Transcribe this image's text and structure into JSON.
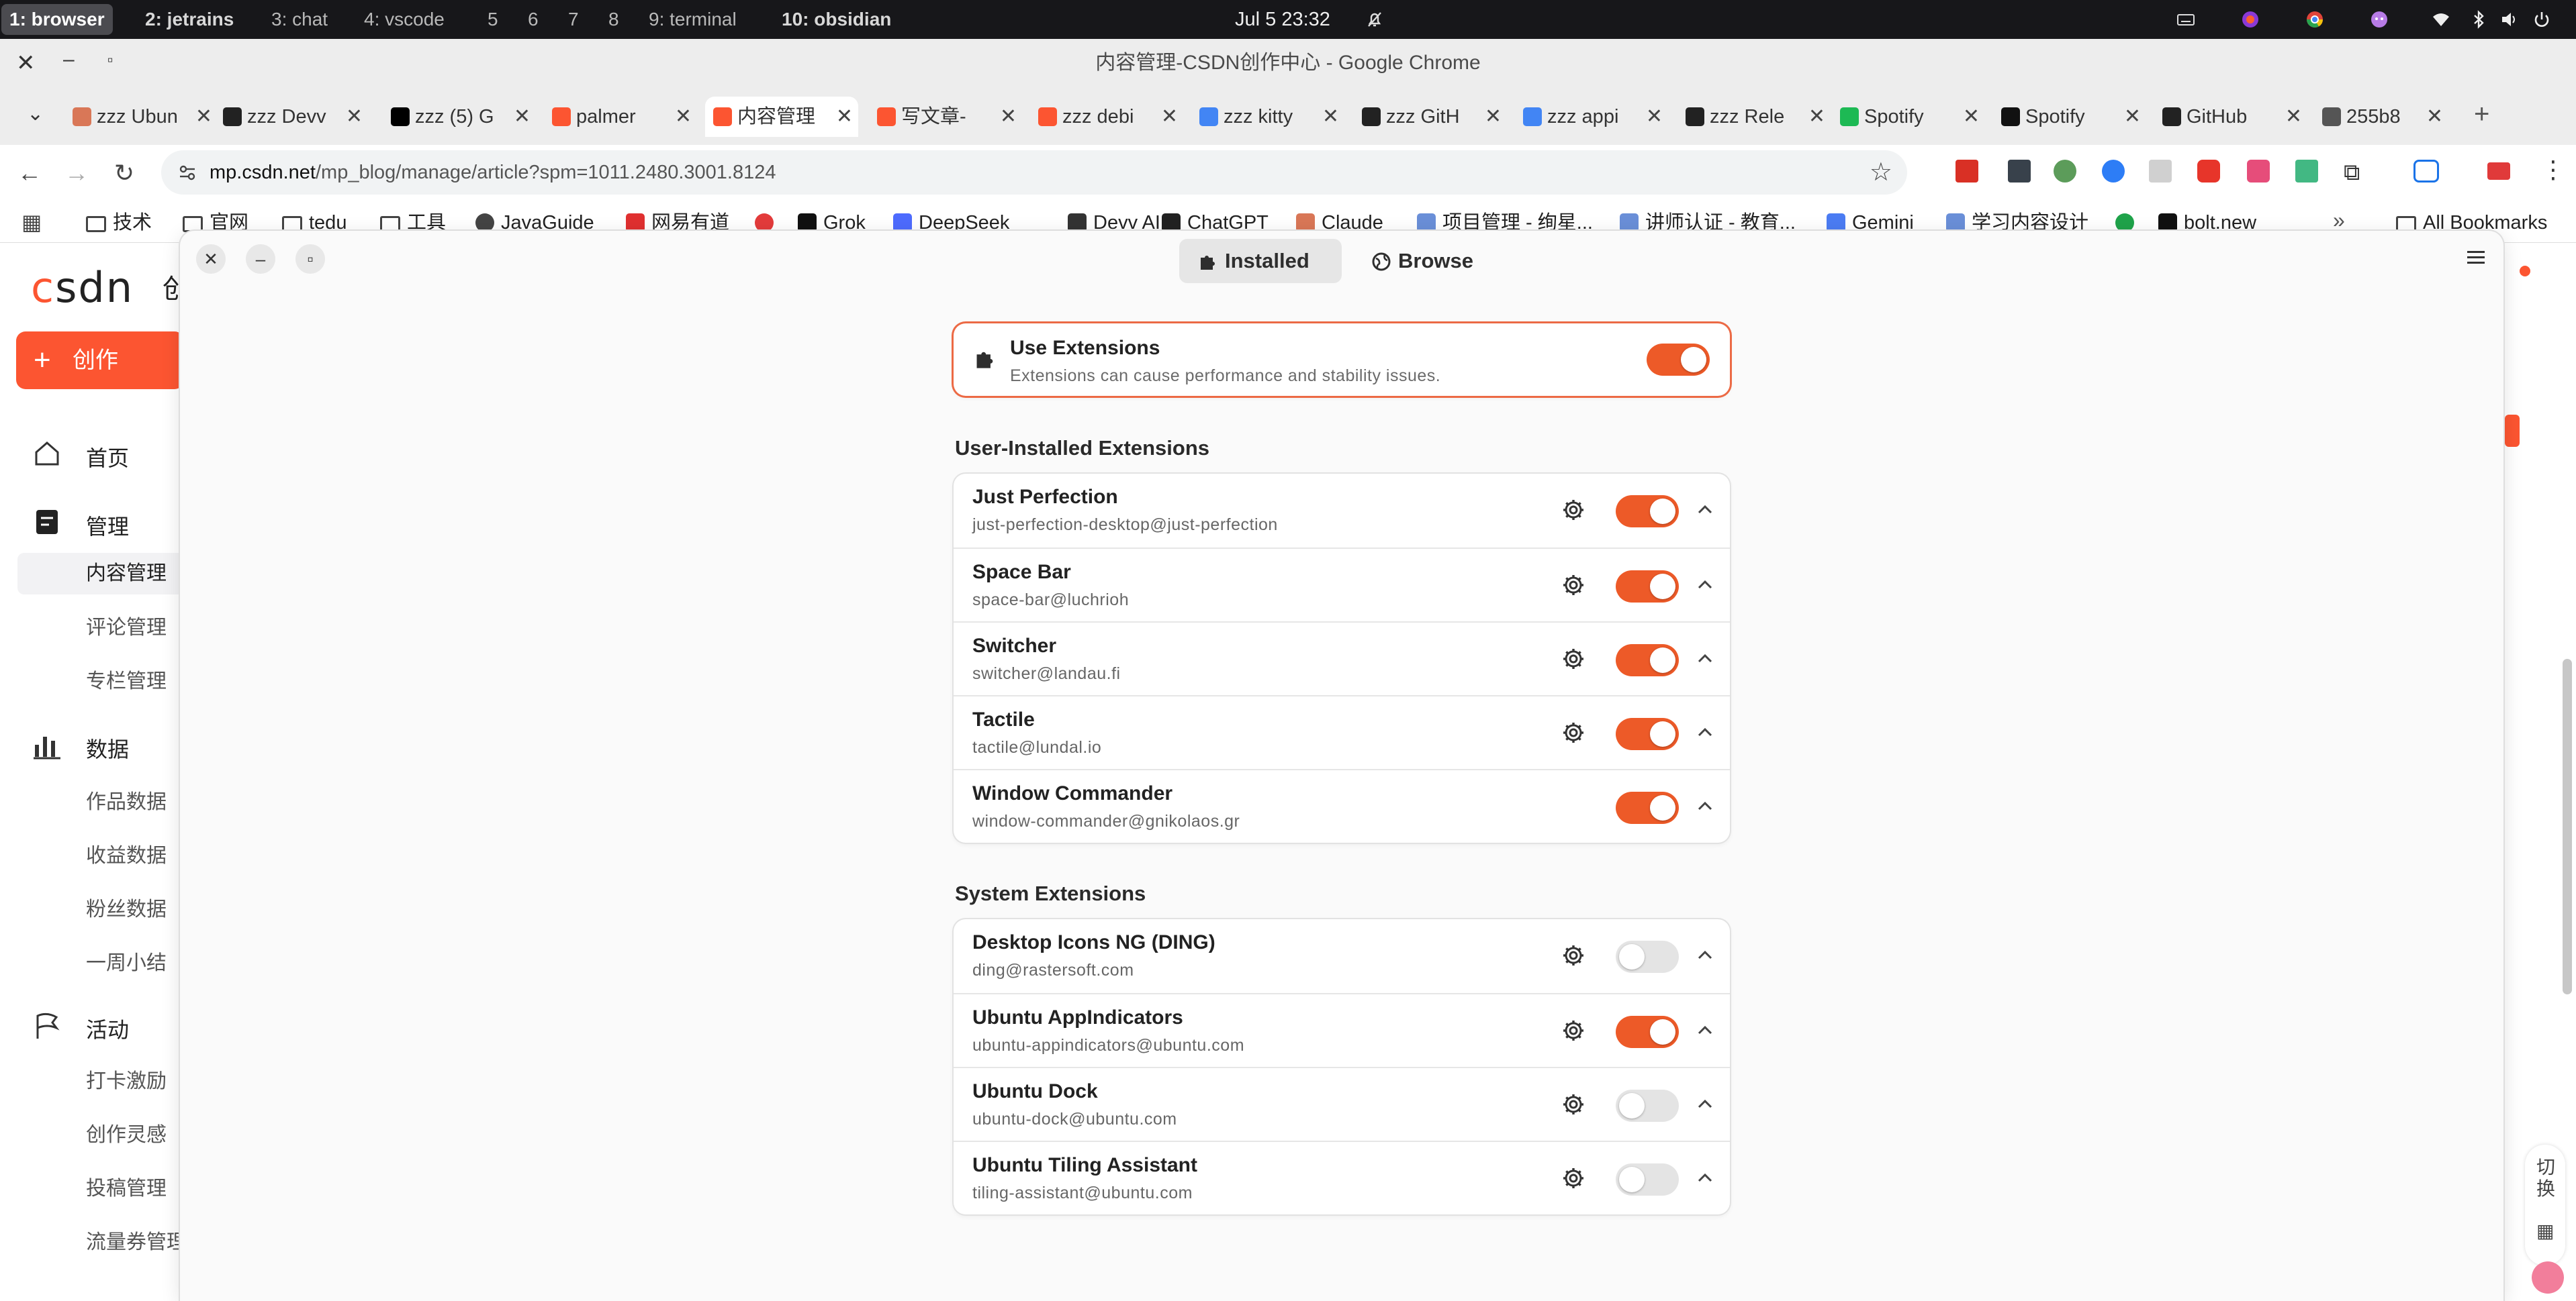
{
  "system_bar": {
    "workspaces": [
      {
        "label": "1: browser",
        "active": true
      },
      {
        "label": "2: jetrains",
        "active": false
      },
      {
        "label": "3: chat",
        "active": false
      },
      {
        "label": "4: vscode",
        "active": false
      },
      {
        "label": "5",
        "active": false
      },
      {
        "label": "6",
        "active": false
      },
      {
        "label": "7",
        "active": false
      },
      {
        "label": "8",
        "active": false
      },
      {
        "label": "9: terminal",
        "active": false
      },
      {
        "label": "10: obsidian",
        "active": false
      }
    ],
    "clock": "Jul 5  23:32"
  },
  "chrome": {
    "window_title": "内容管理-CSDN创作中心 - Google Chrome",
    "tabs": [
      {
        "label": "zzz Ubun",
        "icon": "claude-icon",
        "color": "#d97757"
      },
      {
        "label": "zzz Devv",
        "icon": "devv-icon",
        "color": "#222222"
      },
      {
        "label": "zzz (5) G",
        "icon": "x-icon",
        "color": "#000000"
      },
      {
        "label": "palmer",
        "icon": "csdn-icon",
        "color": "#fc5531"
      },
      {
        "label": "内容管理",
        "icon": "csdn-icon",
        "color": "#fc5531",
        "active": true
      },
      {
        "label": "写文章-",
        "icon": "csdn-icon",
        "color": "#fc5531"
      },
      {
        "label": "zzz debi",
        "icon": "csdn-icon",
        "color": "#fc5531"
      },
      {
        "label": "zzz kitty",
        "icon": "google-icon",
        "color": "#4285f4"
      },
      {
        "label": "zzz GitH",
        "icon": "github-icon",
        "color": "#222222"
      },
      {
        "label": "zzz appi",
        "icon": "google-icon",
        "color": "#4285f4"
      },
      {
        "label": "zzz Rele",
        "icon": "github-icon",
        "color": "#222222"
      },
      {
        "label": "Spotify",
        "icon": "spotify-icon",
        "color": "#1db954"
      },
      {
        "label": "Spotify",
        "icon": "spotify-icon",
        "color": "#111111"
      },
      {
        "label": "GitHub",
        "icon": "github-icon",
        "color": "#222222"
      },
      {
        "label": "255b8",
        "icon": "globe-icon",
        "color": "#555555"
      }
    ],
    "url_host": "mp.csdn.net",
    "url_path": "/mp_blog/manage/article?spm=1011.2480.3001.8124",
    "bookmarks": [
      {
        "label": "技术",
        "icon": "folder-icon"
      },
      {
        "label": "官网",
        "icon": "folder-icon"
      },
      {
        "label": "tedu",
        "icon": "folder-icon"
      },
      {
        "label": "工具",
        "icon": "folder-icon"
      },
      {
        "label": "JavaGuide",
        "icon": "globe-icon"
      },
      {
        "label": "网易有道",
        "icon": "youdao-icon"
      },
      {
        "label": "",
        "icon": "check-icon"
      },
      {
        "label": "Grok",
        "icon": "x-icon"
      },
      {
        "label": "DeepSeek",
        "icon": "deepseek-icon"
      },
      {
        "label": "Devv AI",
        "icon": "devv-icon"
      },
      {
        "label": "ChatGPT",
        "icon": "openai-icon"
      },
      {
        "label": "Claude",
        "icon": "claude-icon"
      },
      {
        "label": "项目管理 - 绚星...",
        "icon": "app-icon"
      },
      {
        "label": "讲师认证 - 教育...",
        "icon": "app-icon"
      },
      {
        "label": "Gemini",
        "icon": "gemini-icon"
      },
      {
        "label": "学习内容设计",
        "icon": "app-icon"
      },
      {
        "label": "",
        "icon": "leaf-icon"
      },
      {
        "label": "bolt.new",
        "icon": "bolt-icon"
      }
    ],
    "all_bookmarks": "All Bookmarks"
  },
  "csdn": {
    "logo": "CSDN",
    "create_button": "创作",
    "menu": {
      "home": "首页",
      "manage": "管理",
      "manage_items": [
        "内容管理",
        "评论管理",
        "专栏管理"
      ],
      "data": "数据",
      "data_items": [
        "作品数据",
        "收益数据",
        "粉丝数据",
        "一周小结"
      ],
      "activity": "活动",
      "activity_items": [
        "打卡激励",
        "创作灵感",
        "投稿管理",
        "流量券管理"
      ]
    },
    "right_float": [
      "切换"
    ]
  },
  "extensions": {
    "tabs": {
      "installed": "Installed",
      "browse": "Browse"
    },
    "use_extensions": {
      "title": "Use Extensions",
      "subtitle": "Extensions can cause performance and stability issues.",
      "enabled": true
    },
    "user_section_title": "User-Installed Extensions",
    "user_extensions": [
      {
        "name": "Just Perfection",
        "uuid": "just-perfection-desktop@just-perfection",
        "enabled": true,
        "has_settings": true
      },
      {
        "name": "Space Bar",
        "uuid": "space-bar@luchrioh",
        "enabled": true,
        "has_settings": true
      },
      {
        "name": "Switcher",
        "uuid": "switcher@landau.fi",
        "enabled": true,
        "has_settings": true
      },
      {
        "name": "Tactile",
        "uuid": "tactile@lundal.io",
        "enabled": true,
        "has_settings": true
      },
      {
        "name": "Window Commander",
        "uuid": "window-commander@gnikolaos.gr",
        "enabled": true,
        "has_settings": false
      }
    ],
    "system_section_title": "System Extensions",
    "system_extensions": [
      {
        "name": "Desktop Icons NG (DING)",
        "uuid": "ding@rastersoft.com",
        "enabled": false,
        "has_settings": true
      },
      {
        "name": "Ubuntu AppIndicators",
        "uuid": "ubuntu-appindicators@ubuntu.com",
        "enabled": true,
        "has_settings": true
      },
      {
        "name": "Ubuntu Dock",
        "uuid": "ubuntu-dock@ubuntu.com",
        "enabled": false,
        "has_settings": true
      },
      {
        "name": "Ubuntu Tiling Assistant",
        "uuid": "tiling-assistant@ubuntu.com",
        "enabled": false,
        "has_settings": true
      }
    ],
    "accent": "#ed5a28"
  }
}
